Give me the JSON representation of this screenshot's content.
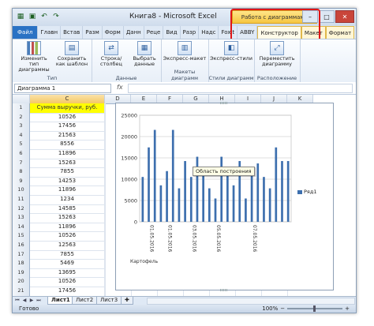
{
  "window": {
    "title": "Книга8 - Microsoft Excel",
    "context_title": "Работа с диаграммами",
    "qat_icons": [
      "excel-icon",
      "save-icon",
      "undo-icon",
      "redo-icon"
    ]
  },
  "tabs": [
    "Файл",
    "Главн",
    "Встав",
    "Разм",
    "Форм",
    "Данн",
    "Реце",
    "Вид",
    "Разр",
    "Надс",
    "Foxit",
    "ABBY",
    "Конструктор",
    "Макет",
    "Формат"
  ],
  "ribbon": {
    "groups": [
      {
        "label": "Тип",
        "buttons": [
          "Изменить тип диаграммы",
          "Сохранить как шаблон"
        ]
      },
      {
        "label": "Данные",
        "buttons": [
          "Строка/столбец",
          "Выбрать данные"
        ]
      },
      {
        "label": "Макеты диаграмм",
        "buttons": [
          "Экспресс-макет"
        ]
      },
      {
        "label": "Стили диаграмм",
        "buttons": [
          "Экспресс-стили"
        ]
      },
      {
        "label": "Расположение",
        "buttons": [
          "Переместить диаграмму"
        ]
      }
    ]
  },
  "formula_bar": {
    "name_box": "Диаграмма 1",
    "fx": "fx",
    "value": ""
  },
  "columns": [
    "C",
    "D",
    "E",
    "F",
    "G",
    "H",
    "I",
    "J",
    "K"
  ],
  "rows": [
    "1",
    "2",
    "3",
    "4",
    "5",
    "6",
    "7",
    "8",
    "9",
    "10",
    "11",
    "12",
    "13",
    "14",
    "15",
    "16",
    "17",
    "18",
    "19",
    "20",
    "21"
  ],
  "column_c": [
    "Сумма выручки, руб.",
    "10526",
    "17456",
    "21563",
    "8556",
    "11896",
    "15263",
    "7855",
    "14253",
    "11896",
    "1234",
    "14585",
    "15263",
    "11896",
    "10526",
    "12563",
    "7855",
    "5469",
    "13695",
    "10526",
    "17456"
  ],
  "chart": {
    "tooltip": "Область построения",
    "legend": "Ряд1",
    "series_color": "#3d6fae"
  },
  "chart_data": {
    "type": "bar",
    "categories": [
      "Картофель",
      "01.05.2016",
      "",
      "",
      "01.05.2016",
      "",
      "",
      "",
      "03.05.2016",
      "",
      "",
      "",
      "05.05.2016",
      "",
      "",
      "",
      "",
      "",
      "07.05.2016",
      "",
      "",
      "",
      "",
      "",
      ""
    ],
    "series": [
      {
        "name": "Ряд1",
        "values": [
          10526,
          17456,
          21563,
          8556,
          11896,
          21563,
          7855,
          14253,
          10526,
          15263,
          11896,
          7855,
          5469,
          15263,
          11896,
          8556,
          14253,
          5469,
          11896,
          13695,
          10526,
          7855,
          17456,
          14253,
          14253
        ]
      }
    ],
    "yticks": [
      0,
      5000,
      10000,
      15000,
      20000,
      25000
    ],
    "ylim": [
      0,
      25000
    ],
    "grid": true,
    "legend_position": "right"
  },
  "sheets": [
    "Лист1",
    "Лист2",
    "Лист3"
  ],
  "status": {
    "text": "Готово",
    "zoom": "100%"
  }
}
